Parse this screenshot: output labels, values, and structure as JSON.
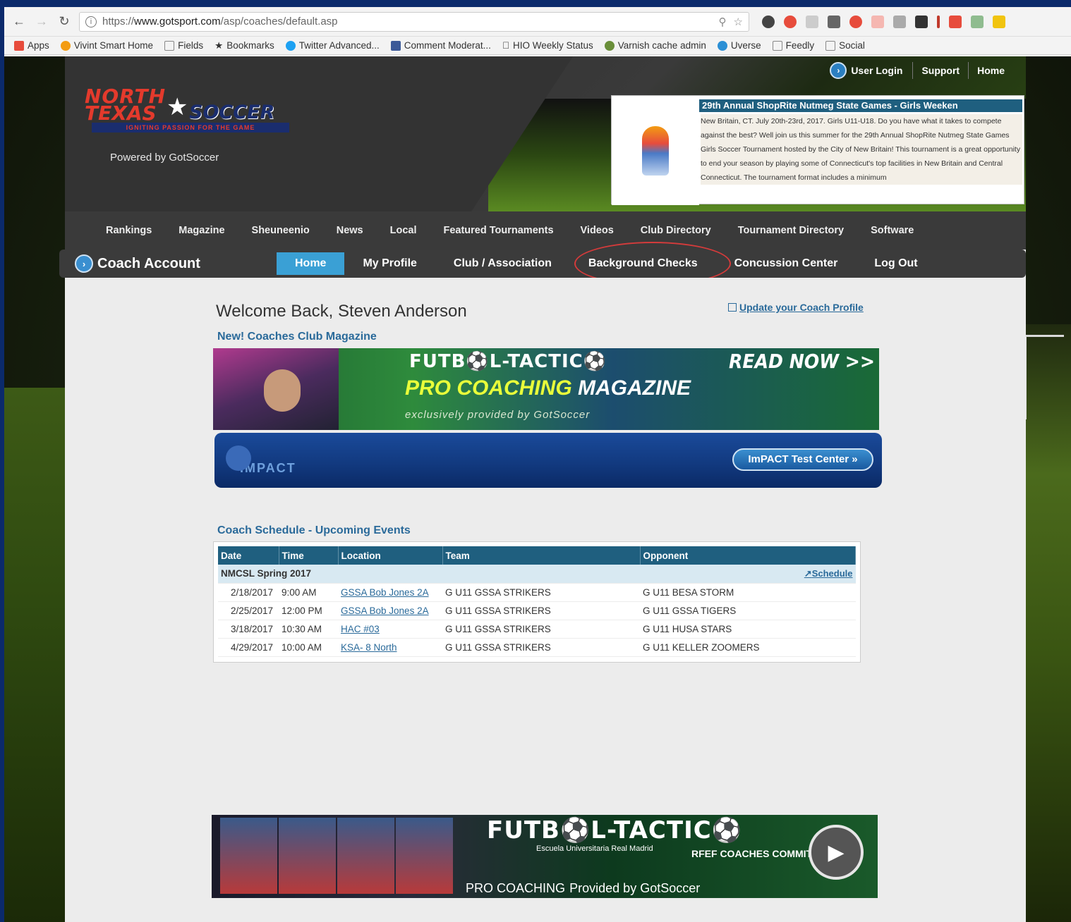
{
  "browser": {
    "url_prefix": "https://",
    "url_domain": "www.gotsport.com",
    "url_path": "/asp/coaches/default.asp",
    "bookmarks": [
      {
        "label": "Apps"
      },
      {
        "label": "Vivint Smart Home"
      },
      {
        "label": "Fields"
      },
      {
        "label": "Bookmarks"
      },
      {
        "label": "Twitter Advanced..."
      },
      {
        "label": "Comment Moderat..."
      },
      {
        "label": "HIO Weekly Status"
      },
      {
        "label": "Varnish cache admin"
      },
      {
        "label": "Uverse"
      },
      {
        "label": "Feedly"
      },
      {
        "label": "Social"
      }
    ]
  },
  "header": {
    "logo_line1": "NORTH",
    "logo_line2": "TEXAS",
    "logo_line3": "SOCCER",
    "logo_tagline": "IGNITING PASSION FOR THE GAME",
    "powered_by": "Powered by GotSoccer",
    "top_links": {
      "user_login": "User Login",
      "support": "Support",
      "home": "Home"
    },
    "promo": {
      "title": "29th Annual ShopRite Nutmeg State Games - Girls Weeken",
      "text": "New Britain, CT. July 20th-23rd, 2017. Girls U11-U18. Do you have what it takes to compete against the best? Well join us this summer for the 29th Annual ShopRite Nutmeg State Games Girls Soccer Tournament hosted by the City of New Britain! This tournament is a great opportunity to end your season by playing some of Connecticut's top facilities in New Britain and Central Connecticut. The tournament format includes a minimum"
    }
  },
  "main_nav": [
    "Rankings",
    "Magazine",
    "Sheuneenio",
    "News",
    "Local",
    "Featured Tournaments",
    "Videos",
    "Club Directory",
    "Tournament Directory",
    "Software"
  ],
  "sub_nav": {
    "section_title": "Coach Account",
    "tabs": [
      "Home",
      "My Profile",
      "Club / Association",
      "Background Checks",
      "Concussion Center",
      "Log Out"
    ]
  },
  "content": {
    "welcome": "Welcome Back, Steven Anderson",
    "update_profile": "Update your Coach Profile",
    "new_magazine": "New! Coaches Club Magazine",
    "banner1": {
      "futbol": "FUTB⚽L-TACTIC⚽",
      "read_now": "READ NOW >>",
      "pro": "PRO COACHING",
      "magazine": "MAGAZINE",
      "exclusively": "exclusively provided by GotSoccer"
    },
    "impact": {
      "logo_text": "IMPACT",
      "button": "ImPACT Test Center »"
    },
    "schedule": {
      "title": "Coach Schedule - Upcoming Events",
      "columns": [
        "Date",
        "Time",
        "Location",
        "Team",
        "Opponent"
      ],
      "group": "NMCSL Spring 2017",
      "schedule_link": "Schedule",
      "rows": [
        {
          "date": "2/18/2017",
          "time": "9:00 AM",
          "location": "GSSA Bob Jones 2A",
          "team": "G U11 GSSA STRIKERS",
          "opponent": "G U11 BESA STORM"
        },
        {
          "date": "2/25/2017",
          "time": "12:00 PM",
          "location": "GSSA Bob Jones 2A",
          "team": "G U11 GSSA STRIKERS",
          "opponent": "G U11 GSSA TIGERS"
        },
        {
          "date": "3/18/2017",
          "time": "10:30 AM",
          "location": "HAC #03",
          "team": "G U11 GSSA STRIKERS",
          "opponent": "G U11 HUSA STARS"
        },
        {
          "date": "4/29/2017",
          "time": "10:00 AM",
          "location": "KSA- 8 North",
          "team": "G U11 GSSA STRIKERS",
          "opponent": "G U11 KELLER ZOOMERS"
        }
      ]
    },
    "banner3": {
      "futbol": "FUTB⚽L-TACTIC⚽",
      "real_madrid": "Escuela Universitaria Real Madrid",
      "rfef": "RFEF COACHES COMMITTEE",
      "pro": "PRO COACHING",
      "provided": "Provided by GotSoccer"
    }
  }
}
